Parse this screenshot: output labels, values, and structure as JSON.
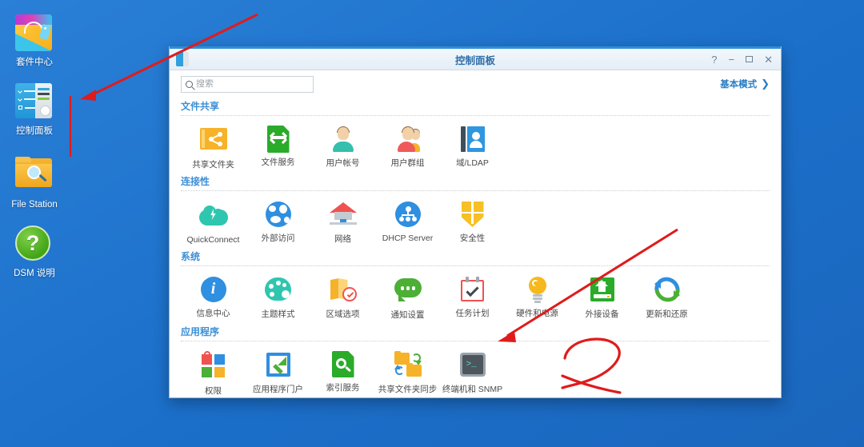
{
  "desktop": {
    "background_color": "#1f76d2",
    "icons": [
      {
        "label": "套件中心",
        "icon": "package-center-icon"
      },
      {
        "label": "控制面板",
        "icon": "control-panel-icon"
      },
      {
        "label": "File Station",
        "icon": "file-station-icon"
      },
      {
        "label": "DSM 说明",
        "icon": "dsm-help-icon",
        "glyph": "?"
      }
    ]
  },
  "window": {
    "title": "控制面板",
    "app_icon": "control-panel-icon",
    "controls": {
      "help": "?",
      "minimize": "−",
      "maximize": "□",
      "close": "✕"
    },
    "search": {
      "placeholder": "搜索",
      "value": "",
      "icon": "search-icon"
    },
    "mode_link": {
      "label": "基本模式",
      "chevron": "❯"
    }
  },
  "sections": [
    {
      "title": "文件共享",
      "items": [
        {
          "label": "共享文件夹",
          "icon": "shared-folder-icon"
        },
        {
          "label": "文件服务",
          "icon": "file-service-icon"
        },
        {
          "label": "用户帐号",
          "icon": "user-account-icon"
        },
        {
          "label": "用户群组",
          "icon": "user-group-icon"
        },
        {
          "label": "域/LDAP",
          "icon": "domain-ldap-icon"
        }
      ]
    },
    {
      "title": "连接性",
      "items": [
        {
          "label": "QuickConnect",
          "icon": "quickconnect-icon"
        },
        {
          "label": "外部访问",
          "icon": "external-access-icon"
        },
        {
          "label": "网络",
          "icon": "network-icon"
        },
        {
          "label": "DHCP Server",
          "icon": "dhcp-server-icon"
        },
        {
          "label": "安全性",
          "icon": "security-icon"
        }
      ]
    },
    {
      "title": "系统",
      "items": [
        {
          "label": "信息中心",
          "icon": "info-center-icon"
        },
        {
          "label": "主题样式",
          "icon": "theme-style-icon"
        },
        {
          "label": "区域选项",
          "icon": "regional-options-icon"
        },
        {
          "label": "通知设置",
          "icon": "notification-icon"
        },
        {
          "label": "任务计划",
          "icon": "task-scheduler-icon"
        },
        {
          "label": "硬件和电源",
          "icon": "hardware-power-icon"
        },
        {
          "label": "外接设备",
          "icon": "external-devices-icon"
        },
        {
          "label": "更新和还原",
          "icon": "update-restore-icon"
        }
      ]
    },
    {
      "title": "应用程序",
      "items": [
        {
          "label": "权限",
          "icon": "privileges-icon"
        },
        {
          "label": "应用程序门户",
          "icon": "application-portal-icon"
        },
        {
          "label": "索引服务",
          "icon": "indexing-service-icon"
        },
        {
          "label": "共享文件夹同步",
          "icon": "shared-folder-sync-icon"
        },
        {
          "label": "终端机和 SNMP",
          "icon": "terminal-snmp-icon",
          "glyph": ">_"
        }
      ]
    }
  ],
  "annotations": {
    "color": "#e01b1b",
    "step_number": "2"
  }
}
